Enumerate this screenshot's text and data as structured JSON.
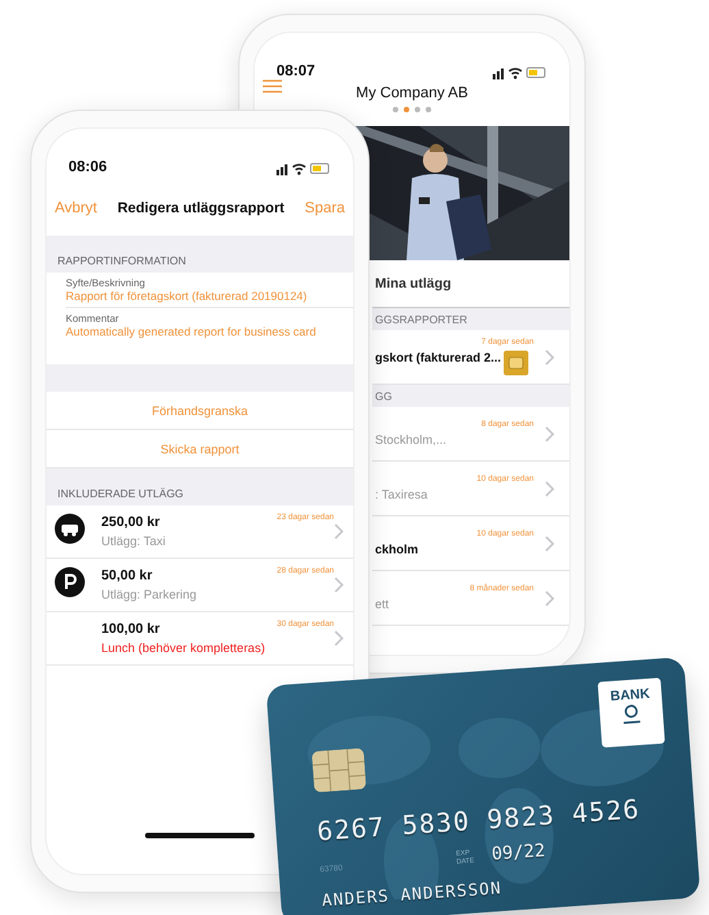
{
  "back_phone": {
    "time": "08:07",
    "title": "My Company AB",
    "page_dots": [
      {
        "selected": false
      },
      {
        "selected": true
      },
      {
        "selected": false
      },
      {
        "selected": false
      }
    ],
    "tab": {
      "label": "Mina utlägg"
    },
    "sections": [
      {
        "header": "GGSRAPPORTER",
        "rows": [
          {
            "kind": "report",
            "age": "7 dagar sedan",
            "title": "gskort (fakturerad 2..."
          }
        ]
      },
      {
        "header": "GG",
        "rows": [
          {
            "kind": "expense",
            "age": "8 dagar sedan",
            "subtitle": "Stockholm,..."
          },
          {
            "kind": "expense",
            "age": "10 dagar sedan",
            "subtitle": ": Taxiresa"
          },
          {
            "kind": "expense",
            "age": "10 dagar sedan",
            "title": "ckholm"
          },
          {
            "kind": "expense",
            "age": "8 månader sedan",
            "subtitle": "ett"
          }
        ]
      }
    ]
  },
  "front_phone": {
    "time": "08:06",
    "cancel": "Avbryt",
    "title": "Redigera utläggsrapport",
    "save": "Spara",
    "info_header": "RAPPORTINFORMATION",
    "fields": [
      {
        "label": "Syfte/Beskrivning",
        "value": "Rapport för företagskort (fakturerad 20190124)"
      },
      {
        "label": "Kommentar",
        "value": "Automatically generated report for business card"
      }
    ],
    "actions": [
      "Förhandsgranska",
      "Skicka rapport"
    ],
    "expenses_header": "INKLUDERADE UTLÄGG",
    "expenses": [
      {
        "kind": "taxi",
        "amount": "250,00 kr",
        "age": "23 dagar sedan",
        "subtitle": "Utlägg: Taxi",
        "incomplete": false
      },
      {
        "kind": "parking",
        "amount": "50,00 kr",
        "age": "28 dagar sedan",
        "subtitle": "Utlägg: Parkering",
        "incomplete": false
      },
      {
        "kind": "plain",
        "amount": "100,00 kr",
        "age": "30 dagar sedan",
        "subtitle": "Lunch (behöver kompletteras)",
        "incomplete": true
      }
    ]
  },
  "card": {
    "bank": "BANK",
    "number": "6267 5830 9823 4526",
    "exp_label": "EXP DATE",
    "expiry": "09/22",
    "code": "63780",
    "holder": "ANDERS ANDERSSON"
  }
}
